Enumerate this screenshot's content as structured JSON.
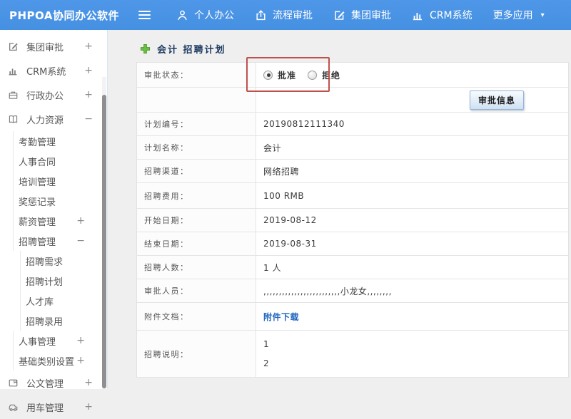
{
  "topbar": {
    "logo": "PHPOA协同办公软件",
    "nav": [
      {
        "label": "个人办公",
        "icon": "user-icon",
        "name": "nav-personal-office"
      },
      {
        "label": "流程审批",
        "icon": "workflow-icon",
        "name": "nav-workflow-approval"
      },
      {
        "label": "集团审批",
        "icon": "edit-icon",
        "name": "nav-group-approval"
      },
      {
        "label": "CRM系统",
        "icon": "chart-icon",
        "name": "nav-crm-system"
      },
      {
        "label": "更多应用",
        "caret": "▾",
        "name": "nav-more-apps"
      }
    ]
  },
  "sidebar": {
    "items": [
      {
        "label": "集团审批",
        "icon": "edit-icon",
        "toggle": "+",
        "classes": [
          "lv1"
        ],
        "name": "sidebar-item-group-approval"
      },
      {
        "label": "CRM系统",
        "icon": "chart-icon",
        "toggle": "+",
        "classes": [
          "lv1"
        ],
        "name": "sidebar-item-crm-system"
      },
      {
        "label": "行政办公",
        "icon": "briefcase-icon",
        "toggle": "+",
        "classes": [
          "lv1"
        ],
        "name": "sidebar-item-admin-office"
      },
      {
        "label": "人力资源",
        "icon": "book-icon",
        "toggle": "−",
        "classes": [
          "lv1"
        ],
        "name": "sidebar-item-human-resources"
      },
      {
        "label": "考勤管理",
        "classes": [
          "lv2"
        ],
        "name": "sidebar-item-attendance-mgmt"
      },
      {
        "label": "人事合同",
        "classes": [
          "lv2"
        ],
        "name": "sidebar-item-hr-contract"
      },
      {
        "label": "培训管理",
        "classes": [
          "lv2"
        ],
        "name": "sidebar-item-training-mgmt"
      },
      {
        "label": "奖惩记录",
        "classes": [
          "lv2"
        ],
        "name": "sidebar-item-reward-records"
      },
      {
        "label": "薪资管理",
        "toggle": "+",
        "classes": [
          "lv2"
        ],
        "name": "sidebar-item-salary-mgmt"
      },
      {
        "label": "招聘管理",
        "toggle": "−",
        "classes": [
          "lv2"
        ],
        "name": "sidebar-item-recruitment-mgmt"
      },
      {
        "label": "招聘需求",
        "classes": [
          "lv3"
        ],
        "name": "sidebar-item-recruitment-needs"
      },
      {
        "label": "招聘计划",
        "classes": [
          "lv3"
        ],
        "name": "sidebar-item-recruitment-plan"
      },
      {
        "label": "人才库",
        "classes": [
          "lv3"
        ],
        "name": "sidebar-item-talent-pool"
      },
      {
        "label": "招聘录用",
        "classes": [
          "lv3"
        ],
        "name": "sidebar-item-recruitment-hiring"
      },
      {
        "label": "人事管理",
        "toggle": "+",
        "classes": [
          "lv2"
        ],
        "name": "sidebar-item-personnel-mgmt"
      },
      {
        "label": "基础类别设置",
        "toggle": "+",
        "classes": [
          "lv2"
        ],
        "name": "sidebar-item-base-category-settings"
      },
      {
        "label": "公文管理",
        "icon": "document-icon",
        "toggle": "+",
        "classes": [
          "lv1"
        ],
        "name": "sidebar-item-document-mgmt"
      },
      {
        "label": "用车管理",
        "icon": "car-icon",
        "toggle": "+",
        "classes": [
          "lv1"
        ],
        "name": "sidebar-item-vehicle-mgmt"
      }
    ]
  },
  "main": {
    "title": "会计 招聘计划",
    "annotation_box_color": "#c0504d",
    "form": {
      "status_label": "审批状态：",
      "approve_label": "批准",
      "reject_label": "拒绝",
      "approve_selected": true,
      "button_label": "审批信息",
      "rows": [
        {
          "label": "计划编号：",
          "value": "20190812111340"
        },
        {
          "label": "计划名称：",
          "value": "会计"
        },
        {
          "label": "招聘渠道：",
          "value": "网络招聘"
        },
        {
          "label": "招聘费用：",
          "value": "100 RMB",
          "classes": [
            "h36"
          ]
        },
        {
          "label": "开始日期：",
          "value": "2019-08-12"
        },
        {
          "label": "结束日期：",
          "value": "2019-08-31"
        },
        {
          "label": "招聘人数：",
          "value": "1 人"
        },
        {
          "label": "审批人员：",
          "value": ",,,,,,,,,,,,,,,,,,,,,,,,,小龙女,,,,,,,,"
        },
        {
          "label": "附件文档：",
          "value": "附件下载",
          "link": true,
          "classes": [
            "h39",
            "linkrow"
          ]
        },
        {
          "label": "招聘说明：",
          "value": "1",
          "value2": "2",
          "classes": [
            "h66",
            "tall"
          ]
        }
      ]
    }
  }
}
